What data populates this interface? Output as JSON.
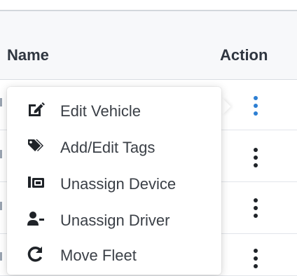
{
  "table": {
    "columns": {
      "name": "Name",
      "action": "Action"
    }
  },
  "menu": {
    "items": [
      {
        "label": "Edit Vehicle",
        "icon": "edit-icon"
      },
      {
        "label": "Add/Edit Tags",
        "icon": "tags-icon"
      },
      {
        "label": "Unassign Device",
        "icon": "device-icon"
      },
      {
        "label": "Unassign Driver",
        "icon": "user-minus-icon"
      },
      {
        "label": "Move Fleet",
        "icon": "redo-icon"
      }
    ]
  },
  "colors": {
    "active_kebab": "#2d7fd3",
    "kebab": "#1f2328",
    "header_text": "#2f3640",
    "menu_text": "#3a3f46"
  }
}
